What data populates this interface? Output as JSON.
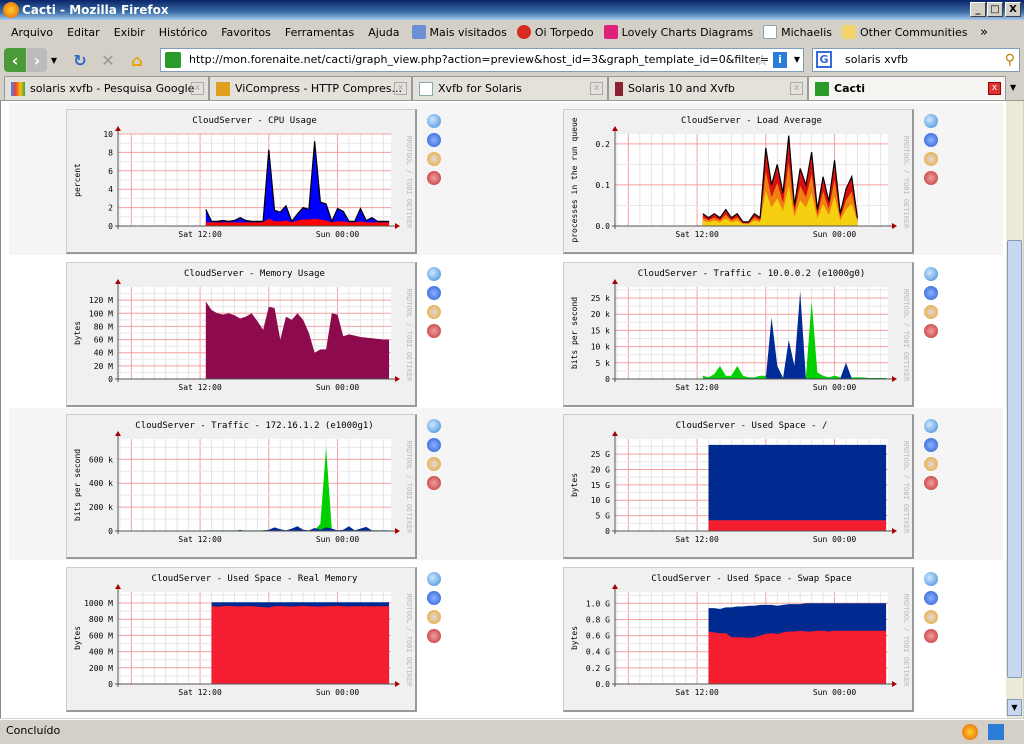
{
  "window": {
    "title": "Cacti - Mozilla Firefox",
    "minimize": "_",
    "maximize": "□",
    "close": "X"
  },
  "menu": [
    "Arquivo",
    "Editar",
    "Exibir",
    "Histórico",
    "Favoritos",
    "Ferramentas",
    "Ajuda"
  ],
  "bookmarks": [
    {
      "label": "Mais visitados",
      "color": "#6b8fd4"
    },
    {
      "label": "Oi Torpedo",
      "color": "#d62b1f"
    },
    {
      "label": "Lovely Charts Diagrams",
      "color": "#e0207a"
    },
    {
      "label": "Michaelis",
      "color": "#ffffff"
    },
    {
      "label": "Other Communities",
      "color": "#f2d26b"
    }
  ],
  "bookmarks_more": "»",
  "nav": {
    "url": "http://mon.forenaite.net/cacti/graph_view.php?action=preview&host_id=3&graph_template_id=0&filter=",
    "search_value": "solaris xvfb"
  },
  "tabs": [
    {
      "label": "solaris xvfb - Pesquisa Google",
      "active": false
    },
    {
      "label": "ViCompress - HTTP Compres...",
      "active": false
    },
    {
      "label": "Xvfb for Solaris",
      "active": false
    },
    {
      "label": "Solaris 10 and Xvfb",
      "active": false
    },
    {
      "label": "Cacti",
      "active": true
    }
  ],
  "status": "Concluído",
  "watermark": "RRDTOOL / TOBI OETIKER",
  "chart_data": [
    {
      "type": "area",
      "title": "CloudServer - CPU Usage",
      "ylabel": "percent",
      "xlim": [
        "Sat 04:50",
        "Sun 04:40"
      ],
      "ylim": [
        0,
        10
      ],
      "yticks": [
        0,
        2,
        4,
        6,
        8,
        10
      ],
      "ytick_labels": [
        "0",
        "2",
        "4",
        "6",
        "8",
        "10"
      ],
      "xtick_labels": [
        "Sat 12:00",
        "Sun 00:00"
      ],
      "grid": true,
      "style": "cpu",
      "series": [
        {
          "color": "#0000ff",
          "outline": "#000000",
          "values": [
            1.8,
            0.5,
            0.5,
            0.6,
            0.5,
            0.6,
            0.9,
            0.6,
            0.5,
            0.5,
            0.5,
            8.3,
            1.7,
            1.5,
            2.2,
            0.5,
            1.3,
            2.0,
            1.8,
            9.2,
            2.6,
            2.4,
            0.5,
            1.9,
            1.6,
            0.5,
            0.5,
            1.9,
            0.6,
            0.9,
            0.5,
            0.5,
            0.5
          ]
        },
        {
          "color": "#ff0000",
          "values": [
            0.4,
            0.4,
            0.4,
            0.4,
            0.4,
            0.4,
            0.4,
            0.4,
            0.4,
            0.4,
            0.4,
            0.8,
            0.5,
            0.5,
            0.6,
            0.4,
            0.6,
            0.7,
            0.7,
            0.8,
            0.7,
            0.6,
            0.4,
            0.5,
            0.5,
            0.4,
            0.4,
            0.5,
            0.4,
            0.4,
            0.4,
            0.4,
            0.4
          ]
        }
      ]
    },
    {
      "type": "area",
      "title": "CloudServer - Load Average",
      "ylabel": "processes in the run queue",
      "xlim": [
        "Sat 04:50",
        "Sun 04:40"
      ],
      "ylim": [
        0,
        0.224
      ],
      "yticks": [
        0,
        0.1,
        0.2
      ],
      "ytick_labels": [
        "0.0",
        "0.1",
        "0.2"
      ],
      "xtick_labels": [
        "Sat 12:00",
        "Sun 00:00"
      ],
      "grid": true,
      "style": "load",
      "series": [
        {
          "color": "#cc0000",
          "outline": "#000000",
          "values": [
            0.03,
            0.02,
            0.03,
            0.02,
            0.04,
            0.02,
            0.03,
            0.01,
            0.01,
            0.03,
            0.02,
            0.19,
            0.1,
            0.15,
            0.08,
            0.22,
            0.05,
            0.14,
            0.1,
            0.18,
            0.04,
            0.12,
            0.06,
            0.16,
            0.03,
            0.09,
            0.12,
            0.02,
            null,
            null,
            null,
            null,
            null
          ]
        }
      ]
    },
    {
      "type": "area",
      "title": "CloudServer - Memory Usage",
      "ylabel": "bytes",
      "xlim": [
        "Sat 04:50",
        "Sun 04:40"
      ],
      "ylim": [
        0,
        140
      ],
      "yticks": [
        0,
        20,
        40,
        60,
        80,
        100,
        120
      ],
      "ytick_labels": [
        "0",
        "20 M",
        "40 M",
        "60 M",
        "80 M",
        "100 M",
        "120 M"
      ],
      "xtick_labels": [
        "Sat 12:00",
        "Sun 00:00"
      ],
      "grid": true,
      "series": [
        {
          "color": "#8d0a4f",
          "values": [
            118,
            105,
            100,
            98,
            100,
            97,
            92,
            95,
            100,
            88,
            75,
            110,
            108,
            60,
            95,
            90,
            100,
            90,
            70,
            40,
            45,
            45,
            100,
            98,
            65,
            68,
            66,
            64,
            63,
            62,
            61,
            60,
            60
          ]
        }
      ]
    },
    {
      "type": "area",
      "title": "CloudServer - Traffic - 10.0.0.2 (e1000g0)",
      "ylabel": "bits per second",
      "xlim": [
        "Sat 04:50",
        "Sun 04:40"
      ],
      "ylim": [
        0,
        28.4
      ],
      "yticks": [
        0,
        5,
        10,
        15,
        20,
        25
      ],
      "ytick_labels": [
        "0",
        "5 k",
        "10 k",
        "15 k",
        "20 k",
        "25 k"
      ],
      "xtick_labels": [
        "Sat 12:00",
        "Sun 00:00"
      ],
      "grid": true,
      "series": [
        {
          "color": "#00cf00",
          "values": [
            1,
            0.5,
            1.5,
            4,
            1,
            1,
            4,
            1,
            0.5,
            0.5,
            1,
            1,
            3,
            4,
            0.5,
            0.5,
            1,
            1,
            0.5,
            24,
            2,
            1,
            0.5,
            1,
            0.5,
            1,
            0.5,
            0.5,
            0.5,
            0.3,
            0.3,
            0.3,
            0.3
          ]
        },
        {
          "color": "#002a97",
          "values": [
            0.2,
            0.2,
            0.2,
            0.2,
            0.2,
            0.2,
            0.2,
            0.2,
            0.2,
            0.2,
            0.2,
            0.2,
            19,
            4,
            0.2,
            12,
            4,
            27,
            0.2,
            0.2,
            0.2,
            0.2,
            0.2,
            0.2,
            0.2,
            5,
            0.2,
            0.2,
            0.2,
            0.2,
            0.2,
            0.2,
            0.2
          ],
          "line": true
        }
      ]
    },
    {
      "type": "area",
      "title": "CloudServer - Traffic - 172.16.1.2 (e1000g1)",
      "ylabel": "bits per second",
      "xlim": [
        "Sat 04:50",
        "Sun 04:40"
      ],
      "ylim": [
        0,
        770
      ],
      "yticks": [
        0,
        200,
        400,
        600
      ],
      "ytick_labels": [
        "0",
        "200 k",
        "400 k",
        "600 k"
      ],
      "xtick_labels": [
        "Sat 12:00",
        "Sun 00:00"
      ],
      "grid": true,
      "series": [
        {
          "color": "#00cf00",
          "values": [
            5,
            5,
            5,
            5,
            5,
            5,
            5,
            5,
            5,
            5,
            5,
            5,
            5,
            5,
            5,
            5,
            5,
            5,
            5,
            5,
            60,
            700,
            10,
            5,
            5,
            5,
            5,
            5,
            5,
            5,
            5,
            5,
            5
          ]
        },
        {
          "color": "#002a97",
          "values": [
            2,
            2,
            2,
            5,
            3,
            2,
            8,
            2,
            2,
            2,
            5,
            10,
            30,
            15,
            5,
            20,
            40,
            10,
            5,
            25,
            10,
            30,
            20,
            5,
            10,
            40,
            5,
            20,
            35,
            5,
            5,
            5,
            5
          ],
          "line": true
        }
      ]
    },
    {
      "type": "area",
      "title": "CloudServer - Used Space - /",
      "ylabel": "bytes",
      "xlim": [
        "Sat 04:50",
        "Sun 04:40"
      ],
      "ylim": [
        0,
        29.9
      ],
      "yticks": [
        0,
        5,
        10,
        15,
        20,
        25
      ],
      "ytick_labels": [
        "0",
        "5 G",
        "10 G",
        "15 G",
        "20 G",
        "25 G"
      ],
      "xtick_labels": [
        "Sat 12:00",
        "Sun 00:00"
      ],
      "grid": true,
      "series": [
        {
          "color": "#002a8f",
          "values": [
            null,
            28,
            28,
            28,
            28,
            28,
            28,
            28,
            28,
            28,
            28,
            28,
            28,
            28,
            28,
            28,
            28,
            28,
            28,
            28,
            28,
            28,
            28,
            28,
            28,
            28,
            28,
            28,
            28,
            28,
            28,
            28,
            28
          ]
        },
        {
          "color": "#f51d30",
          "values": [
            null,
            3.5,
            3.5,
            3.5,
            3.5,
            3.5,
            3.5,
            3.5,
            3.5,
            3.5,
            3.5,
            3.5,
            3.5,
            3.5,
            3.5,
            3.5,
            3.5,
            3.5,
            3.5,
            3.5,
            3.5,
            3.5,
            3.5,
            3.5,
            3.5,
            3.5,
            3.5,
            3.5,
            3.5,
            3.5,
            3.5,
            3.5,
            3.5
          ]
        }
      ]
    },
    {
      "type": "area",
      "title": "CloudServer - Used Space - Real Memory",
      "ylabel": "bytes",
      "xlim": [
        "Sat 04:50",
        "Sun 04:40"
      ],
      "ylim": [
        0,
        1136
      ],
      "yticks": [
        0,
        200,
        400,
        600,
        800,
        1000
      ],
      "ytick_labels": [
        "0",
        "200 M",
        "400 M",
        "600 M",
        "800 M",
        "1000 M"
      ],
      "xtick_labels": [
        "Sat 12:00",
        "Sun 00:00"
      ],
      "grid": true,
      "series": [
        {
          "color": "#002a8f",
          "values": [
            null,
            1010,
            1010,
            1010,
            1010,
            1010,
            1010,
            1010,
            1010,
            1010,
            1010,
            1010,
            1010,
            1010,
            1010,
            1010,
            1010,
            1010,
            1010,
            1010,
            1010,
            1010,
            1010,
            1010,
            1010,
            1010,
            1010,
            1010,
            1010,
            1010,
            1010,
            1010,
            1010
          ]
        },
        {
          "color": "#f51d30",
          "values": [
            null,
            960,
            955,
            960,
            965,
            960,
            958,
            962,
            960,
            955,
            950,
            945,
            960,
            962,
            958,
            955,
            960,
            965,
            960,
            958,
            955,
            960,
            962,
            965,
            960,
            958,
            960,
            962,
            960,
            958,
            960,
            960,
            960
          ]
        }
      ]
    },
    {
      "type": "area",
      "title": "CloudServer - Used Space - Swap Space",
      "ylabel": "bytes",
      "xlim": [
        "Sat 04:50",
        "Sun 04:40"
      ],
      "ylim": [
        0,
        1.14
      ],
      "yticks": [
        0,
        0.2,
        0.4,
        0.6,
        0.8,
        1.0
      ],
      "ytick_labels": [
        "0.0",
        "0.2 G",
        "0.4 G",
        "0.6 G",
        "0.8 G",
        "1.0 G"
      ],
      "xtick_labels": [
        "Sat 12:00",
        "Sun 00:00"
      ],
      "grid": true,
      "series": [
        {
          "color": "#002a8f",
          "values": [
            null,
            0.94,
            0.94,
            0.93,
            0.95,
            0.95,
            0.96,
            0.96,
            0.97,
            0.97,
            0.98,
            0.98,
            0.98,
            0.97,
            0.98,
            0.99,
            0.99,
            0.99,
            1.0,
            1.0,
            1.0,
            1.0,
            1.0,
            1.0,
            1.0,
            1.0,
            1.0,
            1.0,
            1.0,
            1.0,
            1.0,
            1.0,
            1.0
          ]
        },
        {
          "color": "#f51d30",
          "values": [
            null,
            0.65,
            0.64,
            0.63,
            0.63,
            0.58,
            0.58,
            0.58,
            0.57,
            0.58,
            0.6,
            0.62,
            0.63,
            0.62,
            0.64,
            0.65,
            0.65,
            0.66,
            0.65,
            0.65,
            0.66,
            0.66,
            0.65,
            0.66,
            0.66,
            0.66,
            0.66,
            0.66,
            0.66,
            0.66,
            0.66,
            0.66,
            0.66
          ]
        }
      ]
    }
  ],
  "timeline": [
    "Sat 12:30",
    "Sat 13:00",
    "Sat 13:30",
    "Sat 14:00",
    "Sat 14:30",
    "Sat 15:00",
    "Sat 15:30",
    "Sat 16:00",
    "Sat 16:30",
    "Sat 17:00",
    "Sat 17:30",
    "Sat 18:00",
    "Sat 18:30",
    "Sat 19:00",
    "Sat 19:30",
    "Sat 20:00",
    "Sat 20:30",
    "Sat 21:00",
    "Sat 21:30",
    "Sat 22:00",
    "Sat 22:30",
    "Sat 23:00",
    "Sat 23:30",
    "Sun 00:00",
    "Sun 00:30",
    "Sun 01:00",
    "Sun 01:30",
    "Sun 02:00",
    "Sun 02:30",
    "Sun 03:00",
    "Sun 03:30",
    "Sun 04:00",
    "Sun 04:30"
  ]
}
